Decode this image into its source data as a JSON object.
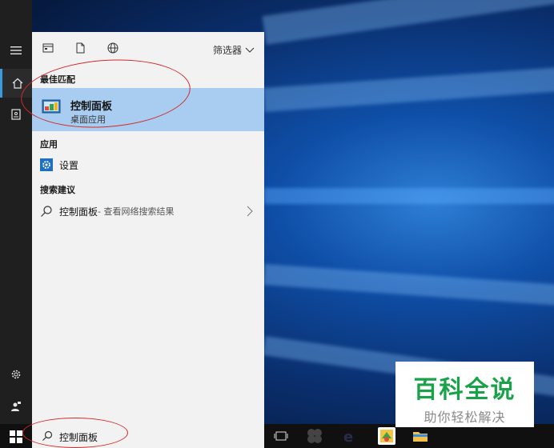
{
  "start_panel": {
    "filter_label": "筛选器",
    "best_match": {
      "heading": "最佳匹配",
      "title": "控制面板",
      "subtitle": "桌面应用"
    },
    "apps": {
      "heading": "应用",
      "items": [
        {
          "label": "设置"
        }
      ]
    },
    "suggestions": {
      "heading": "搜索建议",
      "items": [
        {
          "label": "控制面板",
          "sub": " - 查看网络搜索结果"
        }
      ]
    }
  },
  "taskbar": {
    "search_value": "控制面板"
  },
  "watermark": {
    "main": "百科全说",
    "sub": "助你轻松解决"
  },
  "colors": {
    "accent": "#3a9bdc",
    "highlight": "#a8cdf0",
    "annotation": "#d32a2a",
    "watermark_green": "#1aa24a"
  }
}
